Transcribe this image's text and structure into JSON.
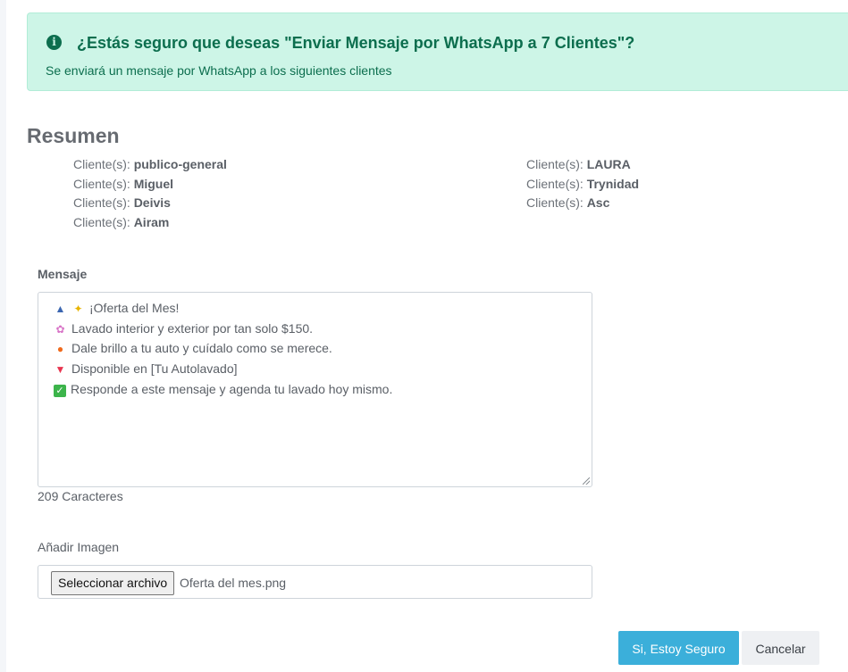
{
  "alert": {
    "icon": "info-icon",
    "title": "¿Estás seguro que deseas \"Enviar Mensaje por WhatsApp a 7 Clientes\"?",
    "text": "Se enviará un mensaje por WhatsApp a los siguientes clientes",
    "colors": {
      "background": "#cdf5e7",
      "text": "#0c6e4e"
    }
  },
  "resumen": {
    "title": "Resumen",
    "prefix": "Cliente(s):",
    "column_left": [
      "publico-general",
      "Miguel",
      "Deivis",
      "Airam"
    ],
    "column_right": [
      "LAURA",
      "Trynidad",
      "Asc"
    ]
  },
  "mensaje": {
    "label": "Mensaje",
    "lines": [
      {
        "icons": [
          "car-icon",
          "sparkles-icon"
        ],
        "text": "¡Oferta del Mes!"
      },
      {
        "icons": [
          "bubbles-icon"
        ],
        "text": "Lavado interior y exterior por tan solo $150."
      },
      {
        "icons": [
          "fire-icon"
        ],
        "text": "Dale brillo a tu auto y cuídalo como se merece."
      },
      {
        "icons": [
          "pin-icon"
        ],
        "text": "Disponible en [Tu Autolavado]"
      },
      {
        "icons": [
          "check-icon"
        ],
        "text": "Responde a este mensaje y agenda tu lavado hoy mismo."
      }
    ],
    "char_count": "209 Caracteres"
  },
  "imagen": {
    "label": "Añadir Imagen",
    "button_label": "Seleccionar archivo",
    "file_name": "Oferta del mes.png"
  },
  "actions": {
    "confirm_label": "Si, Estoy Seguro",
    "cancel_label": "Cancelar",
    "confirm_color": "#3bafda"
  }
}
